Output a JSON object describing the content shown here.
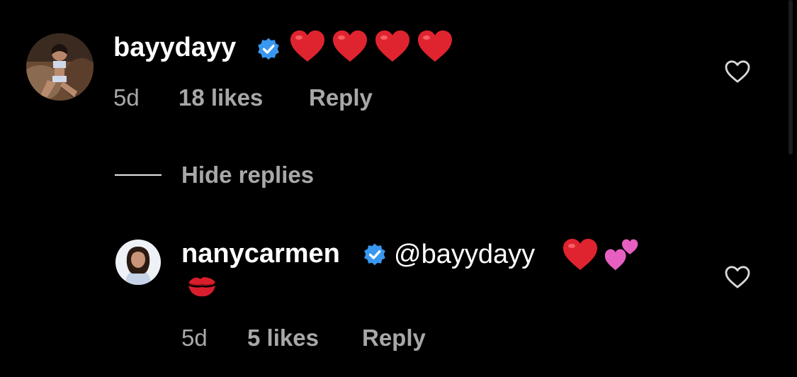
{
  "comments": [
    {
      "username": "bayydayy",
      "verified": true,
      "emoji": [
        "red-heart",
        "red-heart",
        "red-heart",
        "red-heart"
      ],
      "time": "5d",
      "likes": "18 likes",
      "reply_label": "Reply"
    }
  ],
  "hide_replies_label": "Hide replies",
  "replies": [
    {
      "username": "nanycarmen",
      "verified": true,
      "mention": "@bayydayy",
      "emoji": [
        "red-heart",
        "two-hearts",
        "kiss-mark"
      ],
      "time": "5d",
      "likes": "5 likes",
      "reply_label": "Reply"
    }
  ],
  "colors": {
    "background": "#000000",
    "primary_text": "#ffffff",
    "secondary_text": "#a8a8a8",
    "verified_badge": "#3897f0",
    "heart_red": "#e0242f",
    "pink_hearts": "#e75fc0"
  }
}
